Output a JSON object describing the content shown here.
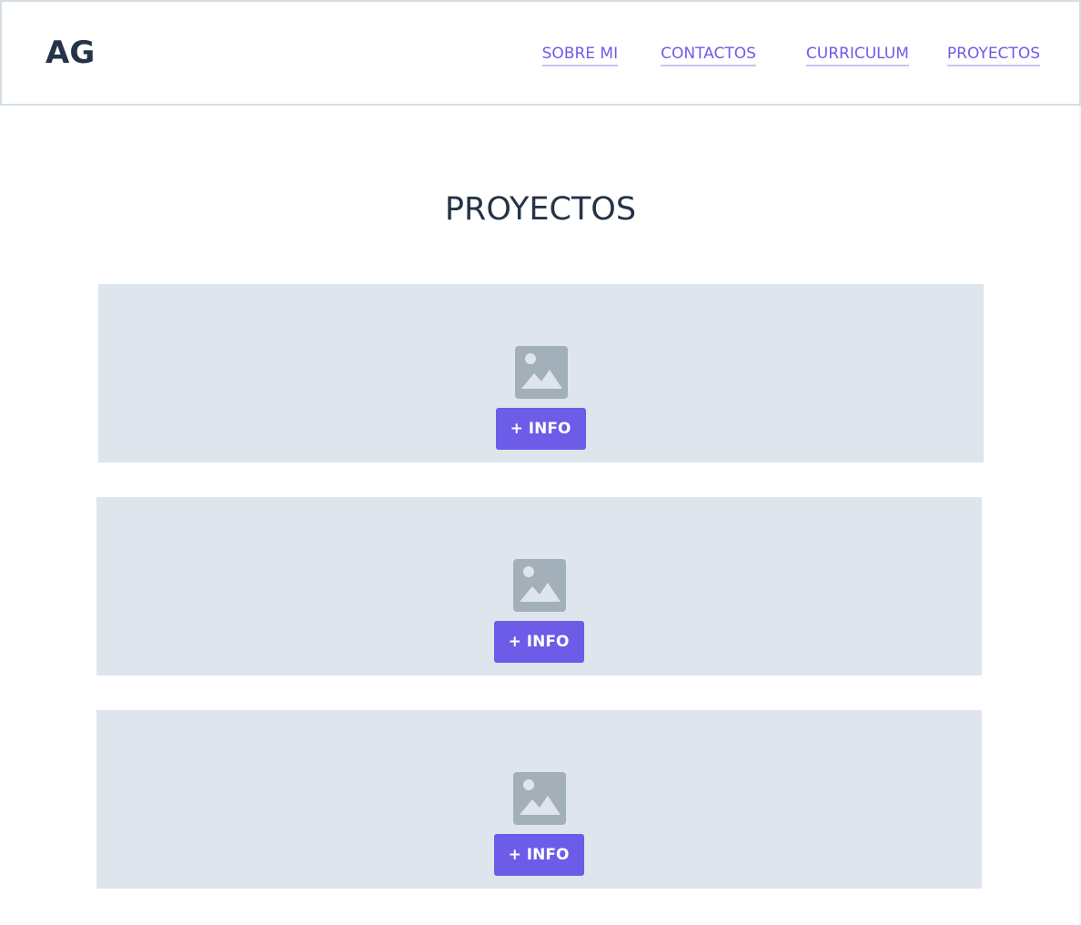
{
  "brand": {
    "logo_text": "AG"
  },
  "navigation": {
    "items": [
      {
        "label": "SOBRE MI"
      },
      {
        "label": "CONTACTOS"
      },
      {
        "label": "CURRICULUM"
      },
      {
        "label": "PROYECTOS"
      }
    ]
  },
  "main": {
    "title": "PROYECTOS",
    "projects": [
      {
        "icon": "image-placeholder-icon",
        "button_label": "+ INFO"
      },
      {
        "icon": "image-placeholder-icon",
        "button_label": "+ INFO"
      },
      {
        "icon": "image-placeholder-icon",
        "button_label": "+ INFO"
      }
    ]
  },
  "colors": {
    "accent": "#6c5ce7",
    "card_background": "#dfe5ed",
    "text": "#243447",
    "placeholder_icon": "#a3afb9"
  }
}
